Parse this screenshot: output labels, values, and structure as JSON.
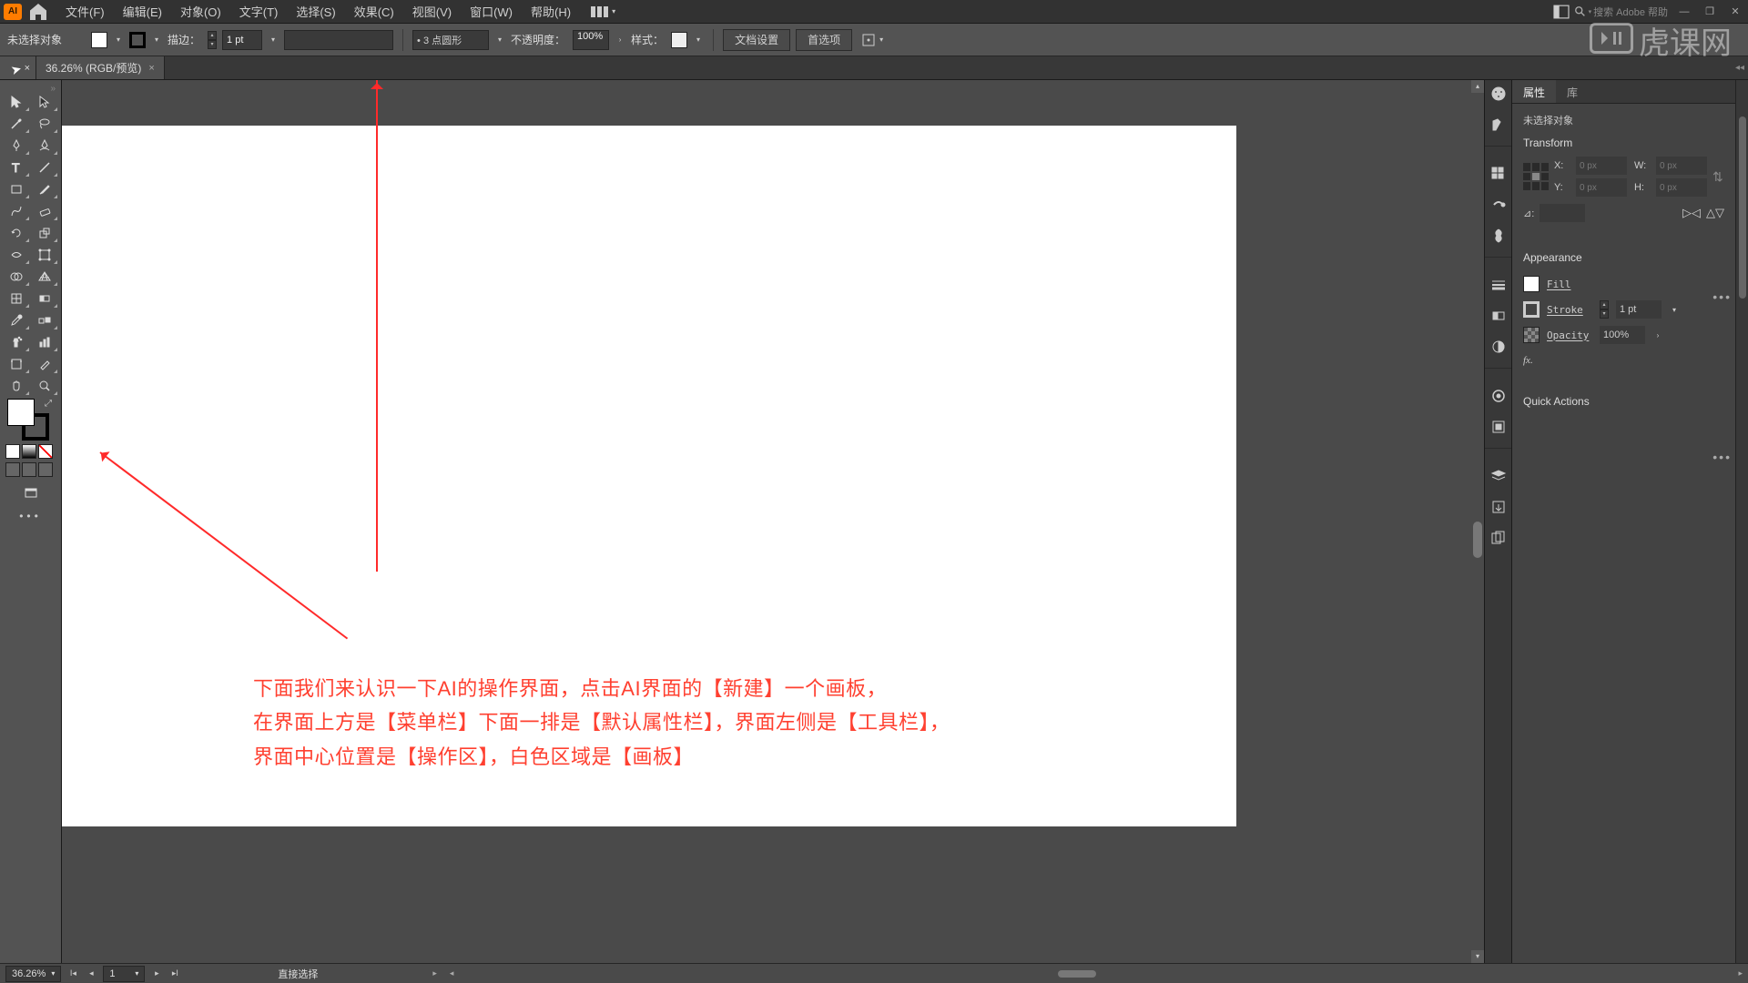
{
  "menubar": {
    "app": "AI",
    "items": [
      "文件(F)",
      "编辑(E)",
      "对象(O)",
      "文字(T)",
      "选择(S)",
      "效果(C)",
      "视图(V)",
      "窗口(W)",
      "帮助(H)"
    ],
    "search_placeholder": "搜索 Adobe 帮助"
  },
  "controlbar": {
    "no_selection": "未选择对象",
    "stroke_label": "描边：",
    "stroke_weight": "1 pt",
    "brush_preset": "•  3 点圆形",
    "opacity_label": "不透明度：",
    "opacity_value": "100%",
    "style_label": "样式：",
    "doc_setup": "文档设置",
    "prefs": "首选项"
  },
  "doctab": {
    "title": "36.26% (RGB/预览)",
    "close": "×"
  },
  "annotation": {
    "l1": "下面我们来认识一下AI的操作界面，点击AI界面的【新建】一个画板，",
    "l2": "在界面上方是【菜单栏】下面一排是【默认属性栏】，界面左侧是【工具栏】，",
    "l3": "界面中心位置是【操作区】，白色区域是【画板】"
  },
  "props": {
    "tab_properties": "属性",
    "tab_library": "库",
    "no_sel": "未选择对象",
    "transform": "Transform",
    "x_label": "X:",
    "x_val": "0 px",
    "y_label": "Y:",
    "y_val": "0 px",
    "w_label": "W:",
    "w_val": "0 px",
    "h_label": "H:",
    "h_val": "0 px",
    "angle_label": "⊿:",
    "appearance": "Appearance",
    "fill": "Fill",
    "stroke": "Stroke",
    "stroke_wt": "1 pt",
    "opacity": "Opacity",
    "opacity_val": "100%",
    "fx": "fx.",
    "quick": "Quick Actions"
  },
  "statusbar": {
    "zoom": "36.26%",
    "artboard_nav": "1",
    "tool": "直接选择"
  },
  "watermark": "虎课网"
}
